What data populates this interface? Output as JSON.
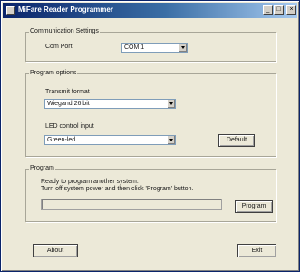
{
  "window": {
    "title": "MiFare Reader Programmer",
    "min_glyph": "_",
    "max_glyph": "□",
    "close_glyph": "×"
  },
  "communication": {
    "group_title": "Communication Settings",
    "com_port_label": "Com Port",
    "com_port_value": "COM 1"
  },
  "program_options": {
    "group_title": "Program options",
    "transmit_format_label": "Transmit format",
    "transmit_format_value": "Wiegand 26 bit",
    "led_control_label": "LED control input",
    "led_control_value": "Green-led",
    "default_button": "Default"
  },
  "program": {
    "group_title": "Program",
    "instructions_line1": "Ready to program another system.",
    "instructions_line2": "Turn off system power and then click 'Program' button.",
    "progress": 0,
    "program_button": "Program"
  },
  "footer": {
    "about_button": "About",
    "exit_button": "Exit"
  }
}
